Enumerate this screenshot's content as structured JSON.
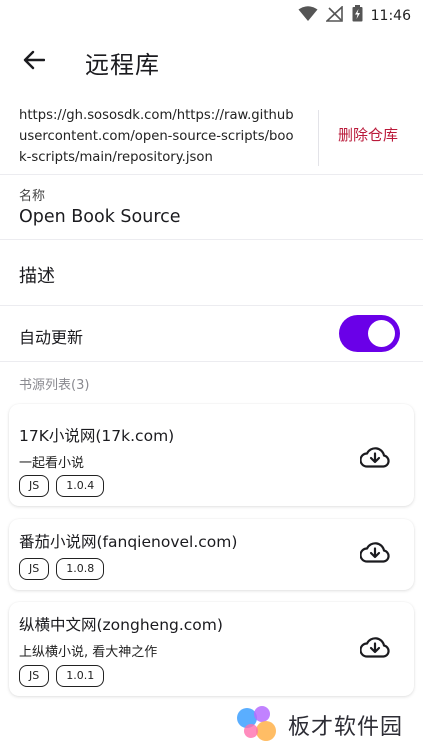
{
  "status_bar": {
    "time": "11:46"
  },
  "app_bar": {
    "title": "远程库"
  },
  "repo": {
    "url": "https://gh.sososdk.com/https://raw.githubusercontent.com/open-source-scripts/book-scripts/main/repository.json",
    "delete_label": "删除仓库",
    "name_label": "名称",
    "name_value": "Open Book Source",
    "description_label": "描述",
    "auto_update_label": "自动更新",
    "auto_update_enabled": true
  },
  "sources_section": {
    "title": "书源列表(3)",
    "items": [
      {
        "title": "17K小说网(17k.com)",
        "description": "一起看小说",
        "lang": "JS",
        "version": "1.0.4"
      },
      {
        "title": "番茄小说网(fanqienovel.com)",
        "description": "",
        "lang": "JS",
        "version": "1.0.8"
      },
      {
        "title": "纵横中文网(zongheng.com)",
        "description": "上纵横小说, 看大神之作",
        "lang": "JS",
        "version": "1.0.1"
      }
    ]
  },
  "watermark": {
    "text": "板才软件园"
  },
  "colors": {
    "accent": "#6a00e8",
    "danger": "#ba1a3a"
  }
}
